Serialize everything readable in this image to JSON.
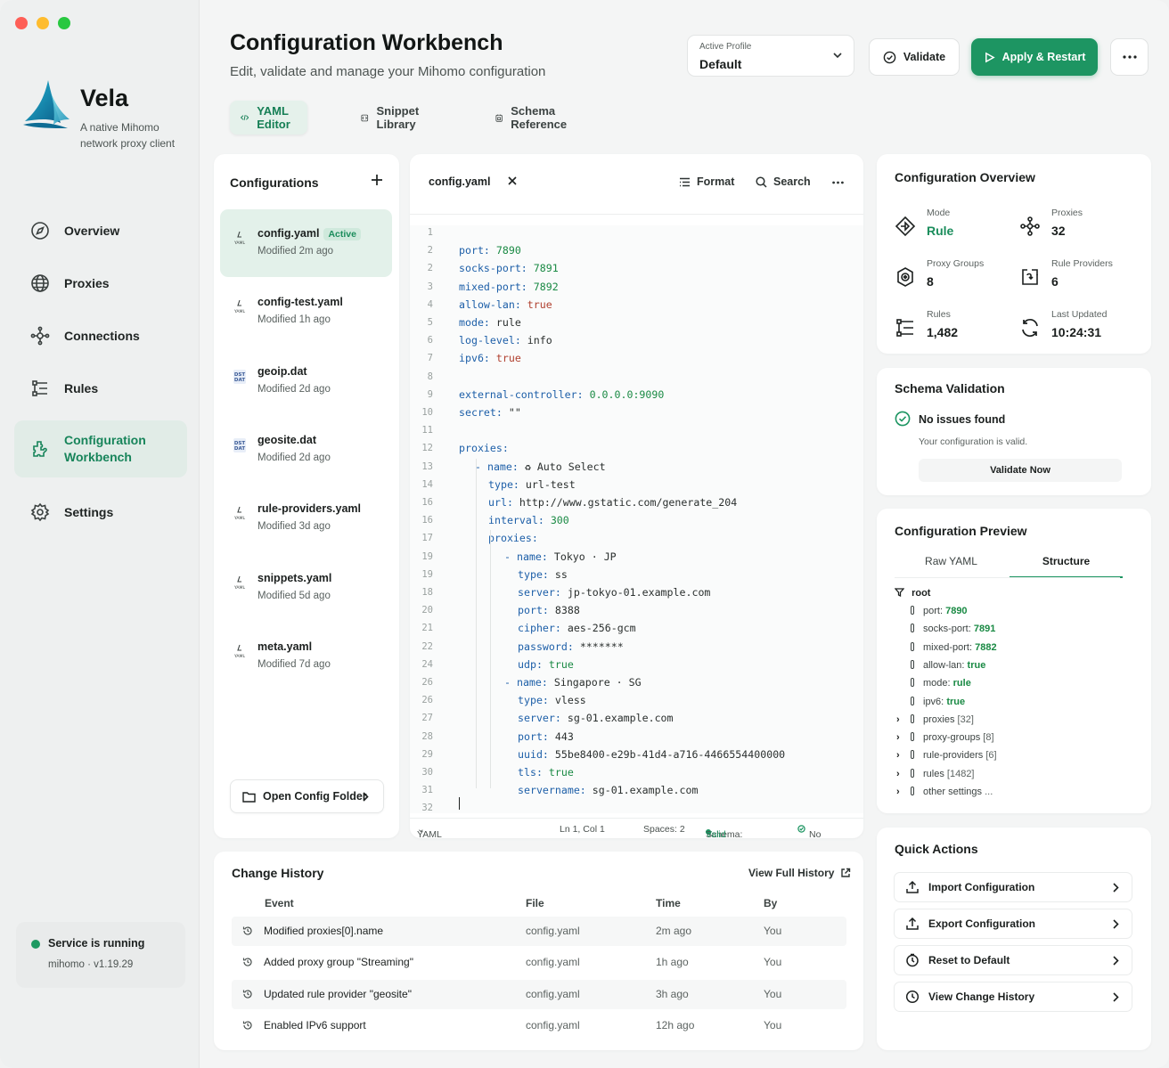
{
  "app": {
    "name": "Vela",
    "tagline": "A native Mihomo network proxy client"
  },
  "nav": [
    {
      "label": "Overview",
      "icon": "compass-icon"
    },
    {
      "label": "Proxies",
      "icon": "globe-icon"
    },
    {
      "label": "Connections",
      "icon": "network-icon"
    },
    {
      "label": "Rules",
      "icon": "rules-icon"
    },
    {
      "label": "Configuration Workbench",
      "icon": "workbench-icon",
      "active": true
    },
    {
      "label": "Settings",
      "icon": "gear-icon"
    }
  ],
  "service": {
    "status": "Service is running",
    "version": "mihomo · v1.19.29"
  },
  "header": {
    "title": "Configuration Workbench",
    "subtitle": "Edit, validate and manage your Mihomo configuration",
    "profile_label": "Active Profile",
    "profile_value": "Default",
    "validate": "Validate",
    "apply": "Apply & Restart"
  },
  "tabs": [
    {
      "label": "YAML Editor",
      "icon": "code-icon",
      "active": true
    },
    {
      "label": "Snippet Library",
      "icon": "snippet-icon"
    },
    {
      "label": "Schema Reference",
      "icon": "schema-icon"
    }
  ],
  "configs": {
    "title": "Configurations",
    "active_badge": "Active",
    "items": [
      {
        "name": "config.yaml",
        "modified": "Modified 2m ago",
        "type": "YAML",
        "active": true
      },
      {
        "name": "config-test.yaml",
        "modified": "Modified 1h ago",
        "type": "YAML"
      },
      {
        "name": "geoip.dat",
        "modified": "Modified 2d ago",
        "type": "DAT"
      },
      {
        "name": "geosite.dat",
        "modified": "Modified 2d ago",
        "type": "DAT"
      },
      {
        "name": "rule-providers.yaml",
        "modified": "Modified 3d ago",
        "type": "YAML"
      },
      {
        "name": "snippets.yaml",
        "modified": "Modified 5d ago",
        "type": "YAML"
      },
      {
        "name": "meta.yaml",
        "modified": "Modified 7d ago",
        "type": "YAML"
      }
    ],
    "open_folder": "Open Config Folder"
  },
  "editor": {
    "file_tab": "config.yaml",
    "format": "Format",
    "search": "Search",
    "lines": [
      {
        "n": "1",
        "indent": 0,
        "key": "",
        "val": "",
        "vt": ""
      },
      {
        "n": "2",
        "indent": 0,
        "key": "port:",
        "val": "7890",
        "vt": "n"
      },
      {
        "n": "2",
        "indent": 0,
        "key": "socks-port:",
        "val": "7891",
        "vt": "n"
      },
      {
        "n": "3",
        "indent": 0,
        "key": "mixed-port:",
        "val": "7892",
        "vt": "n"
      },
      {
        "n": "4",
        "indent": 0,
        "key": "allow-lan:",
        "val": "true",
        "vt": "b"
      },
      {
        "n": "5",
        "indent": 0,
        "key": "mode:",
        "val": "rule",
        "vt": "s"
      },
      {
        "n": "6",
        "indent": 0,
        "key": "log-level:",
        "val": "info",
        "vt": "s"
      },
      {
        "n": "7",
        "indent": 0,
        "key": "ipv6:",
        "val": "true",
        "vt": "b"
      },
      {
        "n": "8",
        "indent": 0,
        "key": "",
        "val": "",
        "vt": ""
      },
      {
        "n": "9",
        "indent": 0,
        "key": "external-controller:",
        "val": "0.0.0.0:9090",
        "vt": "n"
      },
      {
        "n": "10",
        "indent": 0,
        "key": "secret:",
        "val": "\"\"",
        "vt": "s"
      },
      {
        "n": "11",
        "indent": 0,
        "key": "",
        "val": "",
        "vt": ""
      },
      {
        "n": "12",
        "indent": 0,
        "key": "proxies:",
        "val": "",
        "vt": ""
      },
      {
        "n": "13",
        "indent": 1,
        "dash": true,
        "key": "name:",
        "val": "♻ Auto Select",
        "vt": "s"
      },
      {
        "n": "14",
        "indent": 2,
        "key": "type:",
        "val": "url-test",
        "vt": "s"
      },
      {
        "n": "16",
        "indent": 2,
        "key": "url:",
        "val": "http://www.gstatic.com/generate_204",
        "vt": "s"
      },
      {
        "n": "16",
        "indent": 2,
        "key": "interval:",
        "val": "300",
        "vt": "n"
      },
      {
        "n": "17",
        "indent": 2,
        "key": "proxies:",
        "val": "",
        "vt": ""
      },
      {
        "n": "19",
        "indent": 3,
        "dash": true,
        "key": "name:",
        "val": "Tokyo · JP",
        "vt": "s"
      },
      {
        "n": "19",
        "indent": 4,
        "key": "type:",
        "val": "ss",
        "vt": "s"
      },
      {
        "n": "18",
        "indent": 4,
        "key": "server:",
        "val": "jp-tokyo-01.example.com",
        "vt": "s"
      },
      {
        "n": "20",
        "indent": 4,
        "key": "port:",
        "val": "8388",
        "vt": "s"
      },
      {
        "n": "21",
        "indent": 4,
        "key": "cipher:",
        "val": "aes-256-gcm",
        "vt": "s"
      },
      {
        "n": "22",
        "indent": 4,
        "key": "password:",
        "val": "*******",
        "vt": "s"
      },
      {
        "n": "24",
        "indent": 4,
        "key": "udp:",
        "val": "true",
        "vt": "n"
      },
      {
        "n": "26",
        "indent": 3,
        "dash": true,
        "key": "name:",
        "val": "Singapore · SG",
        "vt": "s"
      },
      {
        "n": "26",
        "indent": 4,
        "key": "type:",
        "val": "vless",
        "vt": "s"
      },
      {
        "n": "27",
        "indent": 4,
        "key": "server:",
        "val": "sg-01.example.com",
        "vt": "s"
      },
      {
        "n": "28",
        "indent": 4,
        "key": "port:",
        "val": "443",
        "vt": "s"
      },
      {
        "n": "29",
        "indent": 4,
        "key": "uuid:",
        "val": "55be8400-e29b-41d4-a716-4466554400000",
        "vt": "s"
      },
      {
        "n": "30",
        "indent": 4,
        "key": "tls:",
        "val": "true",
        "vt": "n"
      },
      {
        "n": "31",
        "indent": 4,
        "key": "servername:",
        "val": "sg-01.example.com",
        "vt": "s"
      },
      {
        "n": "32",
        "indent": 0,
        "key": "",
        "val": "",
        "vt": ""
      }
    ],
    "status": {
      "language": "YAML",
      "cursor": "Ln 1, Col 1",
      "spaces": "Spaces: 2",
      "schema_label": "Schema:",
      "schema_value": "Valid",
      "errors": "No errors"
    }
  },
  "overview": {
    "title": "Configuration Overview",
    "items": [
      {
        "label": "Mode",
        "value": "Rule",
        "icon": "mode-icon",
        "green": true
      },
      {
        "label": "Proxies",
        "value": "32",
        "icon": "proxies-icon"
      },
      {
        "label": "Proxy Groups",
        "value": "8",
        "icon": "proxy-groups-icon"
      },
      {
        "label": "Rule Providers",
        "value": "6",
        "icon": "rule-providers-icon"
      },
      {
        "label": "Rules",
        "value": "1,482",
        "icon": "rules-icon"
      },
      {
        "label": "Last Updated",
        "value": "10:24:31",
        "icon": "refresh-icon"
      }
    ]
  },
  "schema": {
    "title": "Schema Validation",
    "status": "No issues found",
    "detail": "Your configuration is valid.",
    "button": "Validate Now"
  },
  "preview": {
    "title": "Configuration Preview",
    "tab_raw": "Raw YAML",
    "tab_structure": "Structure",
    "root": "root",
    "leaves": [
      {
        "key": "port:",
        "val": "7890"
      },
      {
        "key": "socks-port:",
        "val": "7891"
      },
      {
        "key": "mixed-port:",
        "val": "7882"
      },
      {
        "key": "allow-lan:",
        "val": "true"
      },
      {
        "key": "mode:",
        "val": "rule"
      },
      {
        "key": "ipv6:",
        "val": "true"
      }
    ],
    "groups": [
      {
        "key": "proxies",
        "count": "[32]"
      },
      {
        "key": "proxy-groups",
        "count": "[8]"
      },
      {
        "key": "rule-providers",
        "count": "[6]"
      },
      {
        "key": "rules",
        "count": "[1482]"
      },
      {
        "key": "other settings",
        "count": "..."
      }
    ]
  },
  "quick": {
    "title": "Quick Actions",
    "items": [
      {
        "label": "Import Configuration",
        "icon": "import-icon"
      },
      {
        "label": "Export Configuration",
        "icon": "export-icon"
      },
      {
        "label": "Reset to Default",
        "icon": "reset-icon"
      },
      {
        "label": "View Change History",
        "icon": "history-icon"
      }
    ]
  },
  "history": {
    "title": "Change History",
    "link": "View Full History",
    "columns": [
      "Event",
      "File",
      "Time",
      "By"
    ],
    "rows": [
      {
        "event": "Modified proxies[0].name",
        "file": "config.yaml",
        "time": "2m ago",
        "by": "You"
      },
      {
        "event": "Added proxy group \"Streaming\"",
        "file": "config.yaml",
        "time": "1h ago",
        "by": "You"
      },
      {
        "event": "Updated rule provider \"geosite\"",
        "file": "config.yaml",
        "time": "3h ago",
        "by": "You"
      },
      {
        "event": "Enabled IPv6 support",
        "file": "config.yaml",
        "time": "12h ago",
        "by": "You"
      }
    ]
  },
  "colors": {
    "accent": "#1d9562",
    "accent_text": "#17845a",
    "accent_bg": "#e3f1ea",
    "yaml_key": "#1d5fa8",
    "yaml_number": "#1a8a44",
    "yaml_bool": "#b0402f"
  }
}
